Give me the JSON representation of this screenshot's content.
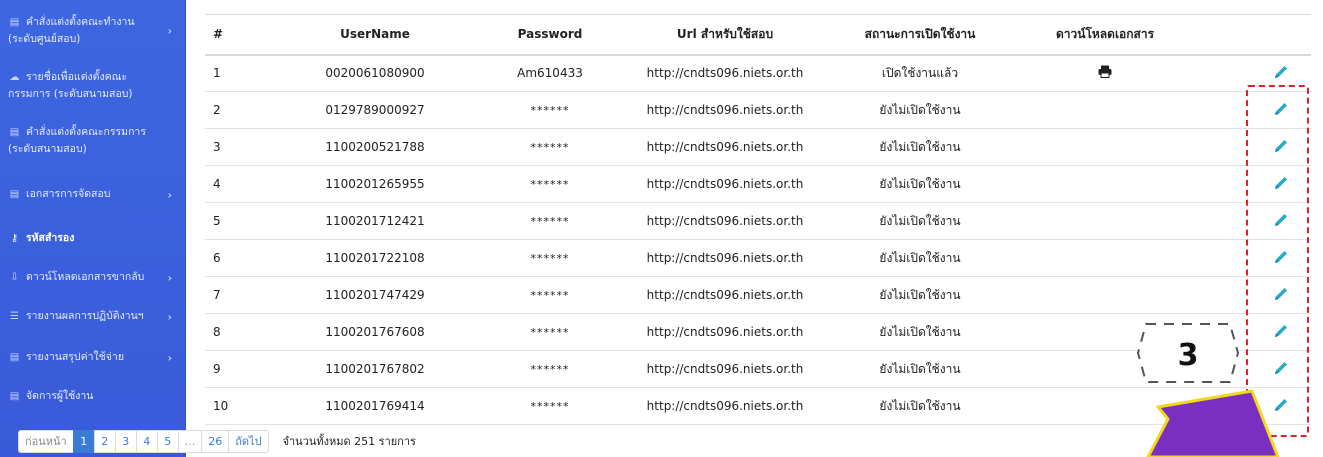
{
  "sidebar": {
    "items": [
      {
        "icon": "document-icon",
        "line1": "คำสั่งแต่งตั้งคณะทำงาน",
        "line2": "(ระดับศูนย์สอบ)",
        "chevron": true
      },
      {
        "icon": "cloud-icon",
        "line1": "รายชื่อเพื่อแต่งตั้งคณะ",
        "line2": "กรรมการ (ระดับสนามสอบ)",
        "chevron": false
      },
      {
        "icon": "document-icon",
        "line1": "คำสั่งแต่งตั้งคณะกรรมการ",
        "line2": "(ระดับสนามสอบ)",
        "chevron": false
      },
      {
        "icon": "document-icon",
        "line1": "เอกสารการจัดสอบ",
        "line2": "",
        "chevron": true
      },
      {
        "icon": "key-icon",
        "line1": "รหัสสำรอง",
        "line2": "",
        "chevron": false,
        "active": true
      },
      {
        "icon": "download-icon",
        "line1": "ดาวน์โหลดเอกสารขากลับ",
        "line2": "",
        "chevron": true
      },
      {
        "icon": "list-icon",
        "line1": "รายงานผลการปฏิบัติงานฯ",
        "line2": "",
        "chevron": true
      },
      {
        "icon": "document-icon",
        "line1": "รายงานสรุปค่าใช้จ่าย",
        "line2": "",
        "chevron": true
      },
      {
        "icon": "document-icon",
        "line1": "จัดการผู้ใช้งาน",
        "line2": "",
        "chevron": false
      }
    ],
    "chevron_glyph": "›"
  },
  "table": {
    "headers": [
      "#",
      "UserName",
      "Password",
      "Url สำหรับใช้สอบ",
      "สถานะการเปิดใช้งาน",
      "ดาวน์โหลดเอกสาร",
      ""
    ],
    "rows": [
      {
        "no": "1",
        "username": "0020061080900",
        "password": "Am610433",
        "url": "http://cndts096.niets.or.th",
        "status": "เปิดใช้งานแล้ว",
        "download": true
      },
      {
        "no": "2",
        "username": "0129789000927",
        "password": "******",
        "url": "http://cndts096.niets.or.th",
        "status": "ยังไม่เปิดใช้งาน",
        "download": false
      },
      {
        "no": "3",
        "username": "1100200521788",
        "password": "******",
        "url": "http://cndts096.niets.or.th",
        "status": "ยังไม่เปิดใช้งาน",
        "download": false
      },
      {
        "no": "4",
        "username": "1100201265955",
        "password": "******",
        "url": "http://cndts096.niets.or.th",
        "status": "ยังไม่เปิดใช้งาน",
        "download": false
      },
      {
        "no": "5",
        "username": "1100201712421",
        "password": "******",
        "url": "http://cndts096.niets.or.th",
        "status": "ยังไม่เปิดใช้งาน",
        "download": false
      },
      {
        "no": "6",
        "username": "1100201722108",
        "password": "******",
        "url": "http://cndts096.niets.or.th",
        "status": "ยังไม่เปิดใช้งาน",
        "download": false
      },
      {
        "no": "7",
        "username": "1100201747429",
        "password": "******",
        "url": "http://cndts096.niets.or.th",
        "status": "ยังไม่เปิดใช้งาน",
        "download": false
      },
      {
        "no": "8",
        "username": "1100201767608",
        "password": "******",
        "url": "http://cndts096.niets.or.th",
        "status": "ยังไม่เปิดใช้งาน",
        "download": false
      },
      {
        "no": "9",
        "username": "1100201767802",
        "password": "******",
        "url": "http://cndts096.niets.or.th",
        "status": "ยังไม่เปิดใช้งาน",
        "download": false
      },
      {
        "no": "10",
        "username": "1100201769414",
        "password": "******",
        "url": "http://cndts096.niets.or.th",
        "status": "ยังไม่เปิดใช้งาน",
        "download": false
      }
    ]
  },
  "pagination": {
    "prev": "ก่อนหน้า",
    "pages": [
      "1",
      "2",
      "3",
      "4",
      "5",
      "...",
      "26"
    ],
    "current": "1",
    "next": "ถัดไป",
    "total": "จำนวนทั้งหมด 251 รายการ"
  },
  "annotation": {
    "step_number": "3"
  },
  "colors": {
    "sidebar": "#3b5fdc",
    "accent": "#3a7bd5",
    "pencil": "#2aa8c9",
    "annotation_box": "#e0202a",
    "arrow_fill": "#7a2fc1",
    "arrow_stroke": "#f2d81a"
  }
}
